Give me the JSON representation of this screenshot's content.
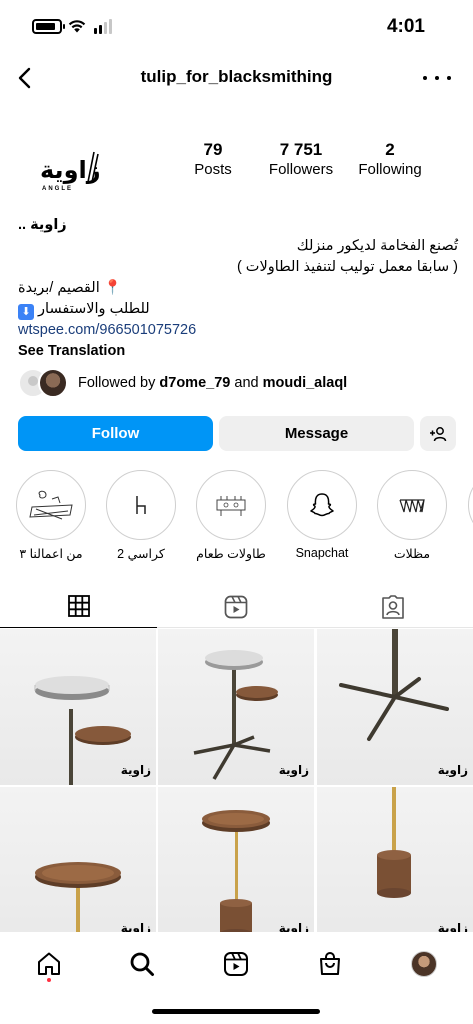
{
  "status_bar": {
    "time": "4:01",
    "battery_level": 0.85
  },
  "nav": {
    "username": "tulip_for_blacksmithing"
  },
  "profile": {
    "logo_text": "زاوية",
    "logo_subtext": "ANGLE",
    "stats": [
      {
        "value": "79",
        "label": "Posts"
      },
      {
        "value": "7 751",
        "label": "Followers"
      },
      {
        "value": "2",
        "label": "Following"
      }
    ]
  },
  "bio": {
    "name": "زاوية ..",
    "line1": "تُصنع الفخامة لديكور منزلك",
    "line2": "( سابقا معمل توليب لتنفيذ الطاولات )",
    "line3": "القصيم /بريدة",
    "line4": "للطلب والاستفسار",
    "link": "wtspee.com/966501075726",
    "see_translation": "See Translation"
  },
  "followed_by": {
    "prefix": "Followed by",
    "user1": "d7ome_79",
    "and": "and",
    "user2": "moudi_alaql"
  },
  "buttons": {
    "follow": "Follow",
    "message": "Message"
  },
  "highlights": [
    {
      "label": "من اعمالنا ٣",
      "icon": "sketch-icon"
    },
    {
      "label": "كراسي 2",
      "icon": "chair-icon"
    },
    {
      "label": "طاولات طعام",
      "icon": "dining-table-icon"
    },
    {
      "label": "Snapchat",
      "icon": "snapchat-ghost-icon"
    },
    {
      "label": "مظلات",
      "icon": "shade-structure-icon"
    }
  ],
  "tabs": [
    "grid-icon",
    "reels-icon",
    "tagged-icon"
  ],
  "grid_watermark": "زاوية",
  "bottom_nav": [
    "home-icon",
    "search-icon",
    "reels-icon",
    "shop-icon",
    "profile-avatar"
  ],
  "colors": {
    "accent": "#0095f6",
    "link": "#1a3d7a",
    "notification_dot": "#ff3040"
  }
}
